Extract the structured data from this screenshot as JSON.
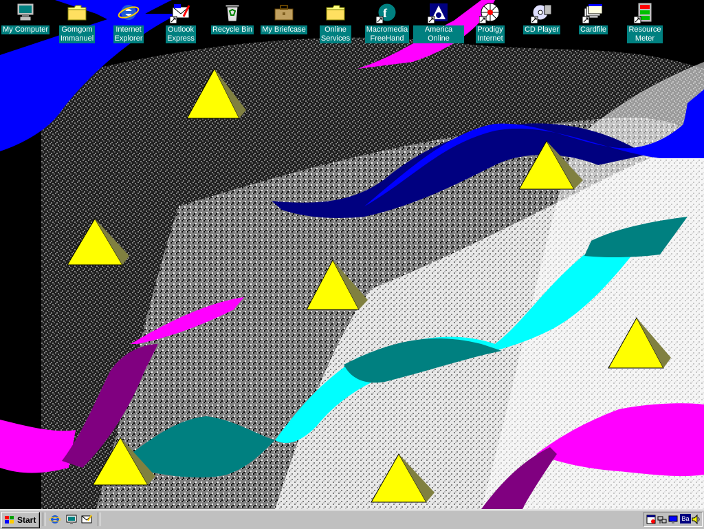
{
  "desktop": {
    "icons": [
      {
        "label": "My Computer",
        "icon": "computer-icon"
      },
      {
        "label": "Gomgom\nImmanuel",
        "icon": "folder-icon"
      },
      {
        "label": "Internet\nExplorer",
        "icon": "internet-explorer-icon"
      },
      {
        "label": "Outlook\nExpress",
        "icon": "outlook-express-icon"
      },
      {
        "label": "Recycle Bin",
        "icon": "recycle-bin-icon"
      },
      {
        "label": "My Briefcase",
        "icon": "briefcase-icon"
      },
      {
        "label": "Online\nServices",
        "icon": "folder-icon"
      },
      {
        "label": "Macromedia\nFreeHand",
        "icon": "freehand-icon"
      },
      {
        "label": "America Online",
        "icon": "aol-icon"
      },
      {
        "label": "Prodigy\nInternet",
        "icon": "prodigy-icon"
      },
      {
        "label": "CD Player",
        "icon": "cd-player-icon"
      },
      {
        "label": "Cardfile",
        "icon": "cardfile-icon"
      },
      {
        "label": "Resource\nMeter",
        "icon": "resource-meter-icon"
      }
    ]
  },
  "taskbar": {
    "start_label": "Start",
    "quick_launch": [
      "internet-explorer-icon",
      "show-desktop-icon",
      "outlook-express-icon"
    ],
    "tray": {
      "icons": [
        "scheduler-icon",
        "network-icon",
        "display-icon",
        "volume-icon"
      ],
      "language": "Ba"
    }
  },
  "colors": {
    "teal": "#008080",
    "taskbar": "#c0c0c0",
    "blue": "#0000ff",
    "navy": "#000080",
    "magenta": "#ff00ff",
    "purple": "#800080",
    "cyan": "#00ffff",
    "yellow": "#ffff00"
  }
}
